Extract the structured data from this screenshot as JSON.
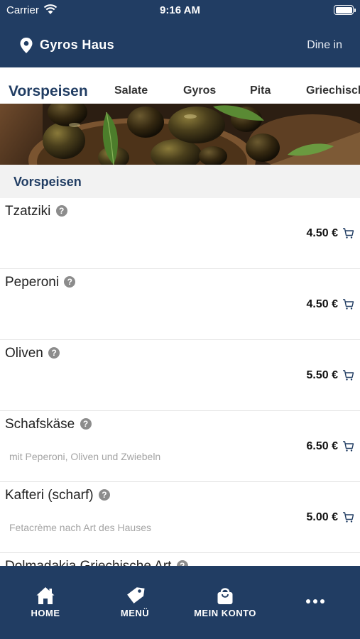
{
  "status_bar": {
    "carrier": "Carrier",
    "time": "9:16 AM"
  },
  "header": {
    "store_name": "Gyros Haus",
    "mode": "Dine in"
  },
  "category_tabs": [
    {
      "label": "Vorspeisen",
      "active": true
    },
    {
      "label": "Salate",
      "active": false
    },
    {
      "label": "Gyros",
      "active": false
    },
    {
      "label": "Pita",
      "active": false
    },
    {
      "label": "Griechisch",
      "active": false
    }
  ],
  "section": {
    "title": "Vorspeisen"
  },
  "items": [
    {
      "name": "Tzatziki",
      "description": "",
      "price": "4.50 €"
    },
    {
      "name": "Peperoni",
      "description": "",
      "price": "4.50 €"
    },
    {
      "name": "Oliven",
      "description": "",
      "price": "5.50 €"
    },
    {
      "name": "Schafskäse",
      "description": "mit Peperoni, Oliven und Zwiebeln",
      "price": "6.50 €"
    },
    {
      "name": "Kafteri (scharf)",
      "description": "Fetacrème nach Art des Hauses",
      "price": "5.00 €"
    },
    {
      "name": "Dolmadakia Griechische Art",
      "description": "",
      "price": ""
    }
  ],
  "info_glyph": "?",
  "bottom_nav": [
    {
      "label": "HOME",
      "icon": "home-icon"
    },
    {
      "label": "MENÜ",
      "icon": "tag-icon"
    },
    {
      "label": "MEIN KONTO",
      "icon": "bag-icon"
    },
    {
      "label": "",
      "icon": "more-icon"
    }
  ],
  "colors": {
    "brand": "#213d63",
    "section_bg": "#f2f2f2",
    "muted_text": "#a4a4a4"
  }
}
